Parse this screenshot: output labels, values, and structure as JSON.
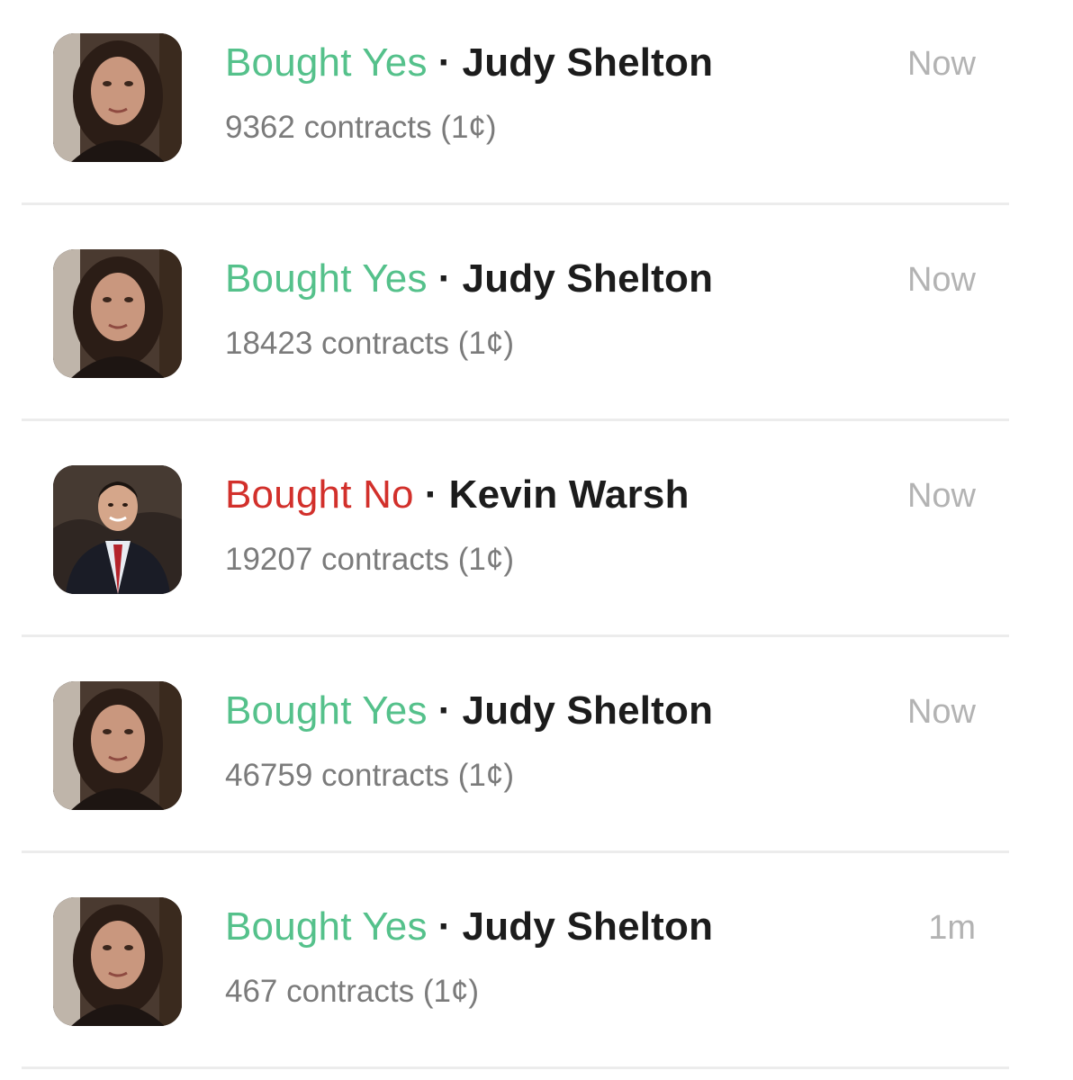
{
  "feed": {
    "items": [
      {
        "action": "Bought Yes",
        "action_kind": "yes",
        "separator": "·",
        "name": "Judy Shelton",
        "detail": "9362 contracts (1¢)",
        "time": "Now",
        "avatar": "judy-shelton-photo"
      },
      {
        "action": "Bought Yes",
        "action_kind": "yes",
        "separator": "·",
        "name": "Judy Shelton",
        "detail": "18423 contracts (1¢)",
        "time": "Now",
        "avatar": "judy-shelton-photo"
      },
      {
        "action": "Bought No",
        "action_kind": "no",
        "separator": "·",
        "name": "Kevin Warsh",
        "detail": "19207 contracts (1¢)",
        "time": "Now",
        "avatar": "kevin-warsh-photo"
      },
      {
        "action": "Bought Yes",
        "action_kind": "yes",
        "separator": "·",
        "name": "Judy Shelton",
        "detail": "46759 contracts (1¢)",
        "time": "Now",
        "avatar": "judy-shelton-photo"
      },
      {
        "action": "Bought Yes",
        "action_kind": "yes",
        "separator": "·",
        "name": "Judy Shelton",
        "detail": "467 contracts (1¢)",
        "time": "1m",
        "avatar": "judy-shelton-photo"
      }
    ]
  },
  "colors": {
    "yes": "#55c18b",
    "no": "#d2302b",
    "name": "#1c1c1c",
    "detail": "#7b7b7b",
    "time": "#b3b3b3",
    "divider": "#ececec"
  }
}
